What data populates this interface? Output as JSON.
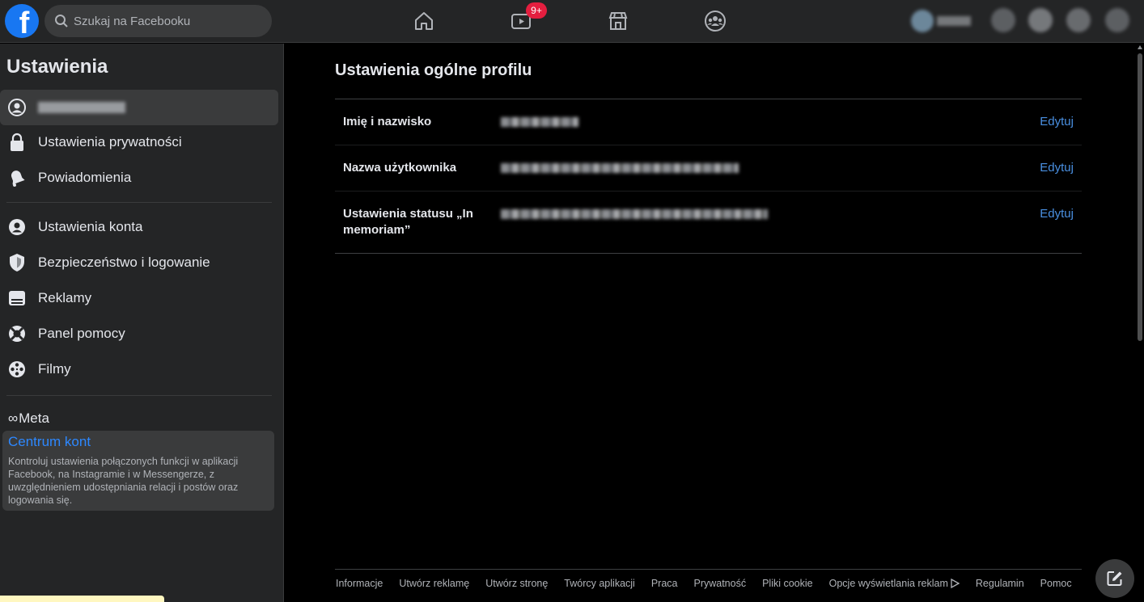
{
  "colors": {
    "brand": "#1877f2",
    "link": "#4a90e2",
    "badge": "#e41e3f",
    "panel": "#242526"
  },
  "header": {
    "logo": "f",
    "search_placeholder": "Szukaj na Facebooku",
    "watch_badge": "9+",
    "nav_icons": [
      "home-icon",
      "watch-icon",
      "marketplace-icon",
      "groups-icon"
    ]
  },
  "sidebar": {
    "title": "Ustawienia",
    "items": [
      {
        "label": "",
        "icon": "profile-icon"
      },
      {
        "label": "Ustawienia prywatności",
        "icon": "lock-icon"
      },
      {
        "label": "Powiadomienia",
        "icon": "bell-icon"
      },
      {
        "label": "Ustawienia konta",
        "icon": "account-icon"
      },
      {
        "label": "Bezpieczeństwo i logowanie",
        "icon": "shield-icon"
      },
      {
        "label": "Reklamy",
        "icon": "ads-icon"
      },
      {
        "label": "Panel pomocy",
        "icon": "lifebuoy-icon"
      },
      {
        "label": "Filmy",
        "icon": "film-reel-icon"
      }
    ],
    "meta_label": "Meta",
    "accounts_center": {
      "title": "Centrum kont",
      "description": "Kontroluj ustawienia połączonych funkcji w aplikacji Facebook, na Instagramie i w Messengerze, z uwzględnieniem udostępniania relacji i postów oraz logowania się."
    }
  },
  "main": {
    "title": "Ustawienia ogólne profilu",
    "rows": [
      {
        "key": "Imię i nazwisko",
        "action": "Edytuj"
      },
      {
        "key": "Nazwa użytkownika",
        "action": "Edytuj"
      },
      {
        "key": "Ustawienia statusu „In memoriam”",
        "action": "Edytuj"
      }
    ]
  },
  "footer": {
    "links": [
      "Informacje",
      "Utwórz reklamę",
      "Utwórz stronę",
      "Twórcy aplikacji",
      "Praca",
      "Prywatność",
      "Pliki cookie",
      "Opcje wyświetlania reklam",
      "Regulamin",
      "Pomoc"
    ]
  }
}
